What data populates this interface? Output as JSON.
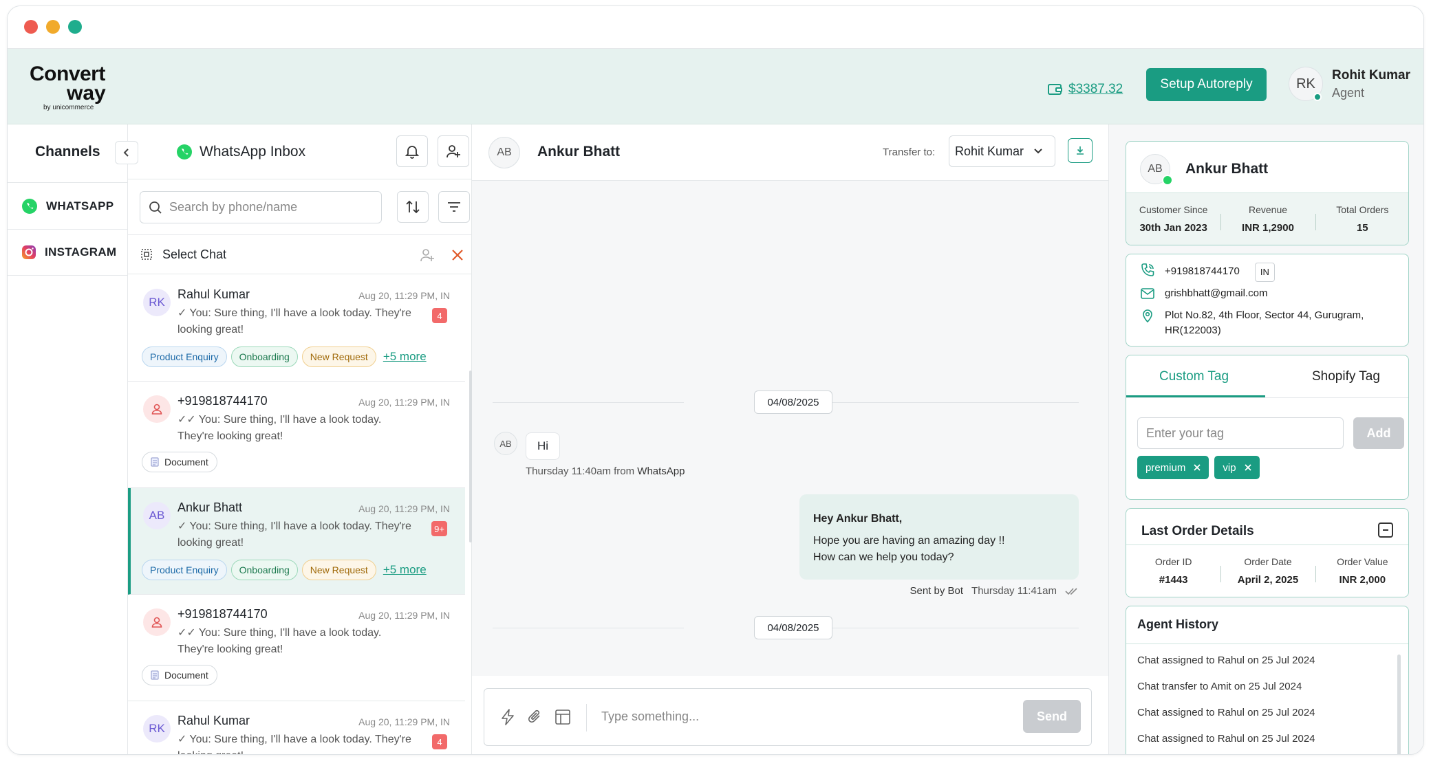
{
  "window_controls": {
    "colors": {
      "close": "#ee5b50",
      "minimize": "#f1aa2b",
      "maximize": "#1fad8d"
    }
  },
  "brand": {
    "line1": "Convert",
    "line2": "way",
    "by": "by unicommerce",
    "accent": "#1a9c82"
  },
  "header": {
    "wallet_balance": "$3387.32",
    "setup_autoreply": "Setup Autoreply",
    "agent": {
      "initials": "RK",
      "name": "Rohit Kumar",
      "role": "Agent"
    }
  },
  "channels": {
    "title": "Channels",
    "items": [
      {
        "label": "WHATSAPP",
        "icon": "whatsapp-icon"
      },
      {
        "label": "INSTAGRAM",
        "icon": "instagram-icon"
      }
    ]
  },
  "inbox": {
    "title": "WhatsApp Inbox",
    "search_placeholder": "Search by phone/name",
    "select_chat": "Select Chat",
    "chats": [
      {
        "initials": "RK",
        "name": "Rahul Kumar",
        "time": "Aug 20, 11:29 PM, IN",
        "message": "You: Sure thing, I'll have a look today. They're looking great!",
        "tick": "✓",
        "badge": "4",
        "tags": [
          "Product Enquiry",
          "Onboarding",
          "New Request"
        ],
        "more": "+5 more"
      },
      {
        "initials": "",
        "name": "+919818744170",
        "time": "Aug 20, 11:29 PM, IN",
        "message": "You: Sure thing, I'll have a look today. They're looking great!",
        "tick": "✓✓",
        "doc": "Document"
      },
      {
        "initials": "AB",
        "name": "Ankur Bhatt",
        "time": "Aug 20, 11:29 PM, IN",
        "message": "You: Sure thing, I'll have a look today. They're looking great!",
        "tick": "✓",
        "badge": "9+",
        "tags": [
          "Product Enquiry",
          "Onboarding",
          "New Request"
        ],
        "more": "+5 more"
      },
      {
        "initials": "",
        "name": "+919818744170",
        "time": "Aug 20, 11:29 PM, IN",
        "message": "You: Sure thing, I'll have a look today. They're looking great!",
        "tick": "✓✓",
        "doc": "Document"
      },
      {
        "initials": "RK",
        "name": "Rahul Kumar",
        "time": "Aug 20, 11:29 PM, IN",
        "message": "You: Sure thing, I'll have a look today. They're looking great!",
        "tick": "✓",
        "badge": "4"
      }
    ]
  },
  "conversation": {
    "contact_initials": "AB",
    "contact_name": "Ankur Bhatt",
    "transfer_label": "Transfer to:",
    "transfer_value": "Rohit Kumar",
    "date1": "04/08/2025",
    "incoming": {
      "initials": "AB",
      "text": "Hi",
      "meta_prefix": "Thursday 11:40am from ",
      "meta_source": "WhatsApp"
    },
    "outgoing": {
      "line1": "Hey Ankur Bhatt,",
      "line2": "Hope you are having an amazing day !!",
      "line3": "How can we help you today?",
      "sender": "Sent by Bot",
      "time": "Thursday 11:41am"
    },
    "date2": "04/08/2025",
    "composer_placeholder": "Type something...",
    "send_label": "Send"
  },
  "customer": {
    "initials": "AB",
    "name": "Ankur Bhatt",
    "stats": [
      {
        "label": "Customer Since",
        "value": "30th Jan 2023"
      },
      {
        "label": "Revenue",
        "value": "INR 1,2900"
      },
      {
        "label": "Total Orders",
        "value": "15"
      }
    ],
    "phone": "+919818744170",
    "country": "IN",
    "email": "grishbhatt@gmail.com",
    "address": "Plot No.82, 4th Floor, Sector 44, Gurugram, HR(122003)"
  },
  "tags_panel": {
    "tab_custom": "Custom Tag",
    "tab_shopify": "Shopify Tag",
    "input_placeholder": "Enter your tag",
    "add_label": "Add",
    "tags": [
      "premium",
      "vip"
    ]
  },
  "last_order": {
    "title": "Last Order Details",
    "fields": [
      {
        "label": "Order ID",
        "value": "#1443"
      },
      {
        "label": "Order Date",
        "value": "April 2, 2025"
      },
      {
        "label": "Order Value",
        "value": "INR 2,000"
      }
    ]
  },
  "agent_history": {
    "title": "Agent History",
    "items": [
      "Chat assigned to Rahul on 25 Jul 2024",
      "Chat transfer to Amit on 25 Jul 2024",
      "Chat assigned to Rahul on 25 Jul 2024",
      "Chat assigned to Rahul on 25 Jul 2024"
    ]
  }
}
